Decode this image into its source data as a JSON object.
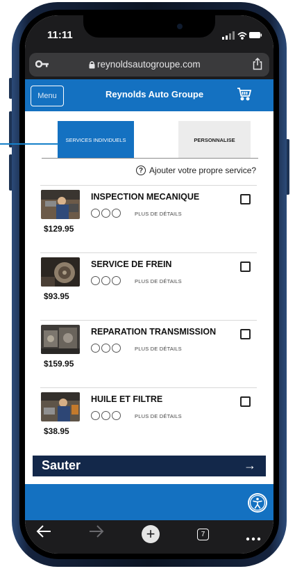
{
  "status": {
    "time": "11:11"
  },
  "browser": {
    "url": "reynoldsautogroupe.com",
    "tab_count": "7"
  },
  "header": {
    "menu_label": "Menu",
    "title": "Reynolds Auto Groupe",
    "cart_icon": "cart-icon"
  },
  "tabs": [
    {
      "label": "SERVICES INDIVIDUELS",
      "active": true
    },
    {
      "label": "PERSONNALISE",
      "active": false
    }
  ],
  "add_service": "Ajouter votre propre service?",
  "services": [
    {
      "title": "INSPECTION MECANIQUE",
      "details": "PLUS DE DÉTAILS",
      "price": "$129.95"
    },
    {
      "title": "SERVICE DE FREIN",
      "details": "PLUS DE DÉTAILS",
      "price": "$93.95"
    },
    {
      "title": "REPARATION TRANSMISSION",
      "details": "PLUS DE DÉTAILS",
      "price": "$159.95"
    },
    {
      "title": "HUILE ET FILTRE",
      "details": "PLUS DE DÉTAILS",
      "price": "$38.95"
    }
  ],
  "skip": {
    "label": "Sauter",
    "arrow": "→"
  },
  "colors": {
    "brand_blue": "#1471c1",
    "navy": "#13284a",
    "chrome": "#1c1c1e"
  }
}
